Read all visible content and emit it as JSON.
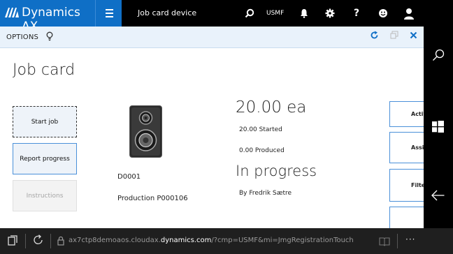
{
  "header": {
    "brand": "Dynamics AX",
    "page_name": "Job card device",
    "company": "USMF"
  },
  "options_bar": {
    "label": "OPTIONS"
  },
  "page": {
    "title": "Job card"
  },
  "actions": {
    "start_job": "Start job",
    "report_progress": "Report progress",
    "instructions": "Instructions"
  },
  "job": {
    "resource_id": "D0001",
    "production": "Production P000106",
    "quantity": "20.00 ea",
    "started": "20.00 Started",
    "produced": "0.00 Produced",
    "status": "In progress",
    "by": "By Fredrik Sætre"
  },
  "side_actions": {
    "activities": "Activities",
    "assign": "Assign",
    "filter": "Filter"
  },
  "browser": {
    "url_prefix": "ax7ctp8demoaos.cloudax.",
    "url_domain": "dynamics.com",
    "url_suffix": "/?cmp=USMF&mi=JmgRegistrationTouch",
    "more": "···"
  },
  "colors": {
    "brand_blue": "#0f6fc6",
    "options_bg": "#e9f2fb",
    "accent": "#4a90d9"
  }
}
